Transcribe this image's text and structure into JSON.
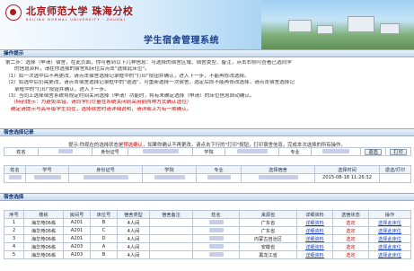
{
  "header": {
    "school_name": "北京师范大学 珠海分校",
    "school_name_en": "BEIJING NORMAL UNIVERSITY · ZHUHAI",
    "system_title": "学生宿舍管理系统"
  },
  "tips": {
    "section_title": "操作提示",
    "line1": "第二步：选择（申请）宿舍，在此页面，你可看到以下几种信息：可选择的宿舍区域、宿舍类型、备注，点击右侧可查看已选同学",
    "line1b": "的信息资料，请在你选择的宿舍和床位后点击\"选择此床位\"。",
    "line2": "（1）如一次选中后不再更改，请点击宿舍选择记录框中的\"打印\"按钮并确认，进入下一步，不能再修改选择。",
    "line3": "（2）如选中后仍需更改，请点击宿舍选择记录框中的\"退选\"，可重新选择一次宿舍，选定后即不能再修改选择，请点击宿舍选择记",
    "line3b": "录框中的\"打印\"按钮并确认，进入下一步。",
    "line4": "（3）当同上选择宿舍系统将规定时间关闭选择（申请）功能时，将有未确定选择（申请）的床位信息自动确认。",
    "warn1": "（特别提示：为避免出错，请同学们尽量在系统关闭前采用前两种方式确认选位）",
    "warn2": "确定请提示与高年级学生同住，选择宿舍时请详细说明，请详细上为有一期确认。"
  },
  "record": {
    "section_title": "宿舍选择记录",
    "hint_prefix": "提示:你现在的选择状态是",
    "hint_status": "预选确认",
    "hint_suffix": "，如果你确认不再更改，请点击下行的\"打印\"按钮，打印宿舍信息，完成本次选择的所有操作。",
    "row1": {
      "name_label": "姓名",
      "id_label": "身份证号",
      "college_label": "学院",
      "specialty_label": "专业",
      "dorm_info_label": "宿舍信息",
      "withdraw": "退选",
      "print": "打印"
    },
    "columns": [
      "姓名",
      "学号",
      "身份证号",
      "学院",
      "专业",
      "选择宿舍",
      "选择时间",
      "退选/打印"
    ],
    "current": {
      "time": "2015-08-18 11:26:32"
    }
  },
  "selection": {
    "section_title": "宿舍选择",
    "columns": [
      "序号",
      "楼栋",
      "房间号",
      "床位号",
      "宿舍类型",
      "宿舍备注",
      "姓名",
      "来源省",
      "详细资料",
      "选宿状态",
      "操作"
    ],
    "rows": [
      {
        "no": "1",
        "building": "海华苑06栋",
        "room": "A201",
        "bed": "B",
        "type": "4人间",
        "note": "",
        "province": "广东省",
        "detail": "详细资料",
        "status": "选定",
        "action": "选择此床位"
      },
      {
        "no": "2",
        "building": "海华苑06栋",
        "room": "A201",
        "bed": "C",
        "type": "4人间",
        "note": "",
        "province": "广东省",
        "detail": "详细资料",
        "status": "选定",
        "action": "选择此床位"
      },
      {
        "no": "3",
        "building": "海华苑06栋",
        "room": "A201",
        "bed": "D",
        "type": "4人间",
        "note": "",
        "province": "内蒙古自治区",
        "detail": "详细资料",
        "status": "选定",
        "action": "选择此床位"
      },
      {
        "no": "4",
        "building": "海华苑06栋",
        "room": "A203",
        "bed": "A",
        "type": "4人间",
        "note": "",
        "province": "安徽省",
        "detail": "详细资料",
        "status": "选定",
        "action": "选择此床位"
      },
      {
        "no": "5",
        "building": "海华苑06栋",
        "room": "A203",
        "bed": "B",
        "type": "4人间",
        "note": "",
        "province": "黑龙江省",
        "detail": "详细资料",
        "status": "选定",
        "action": "选择此床位"
      }
    ]
  }
}
